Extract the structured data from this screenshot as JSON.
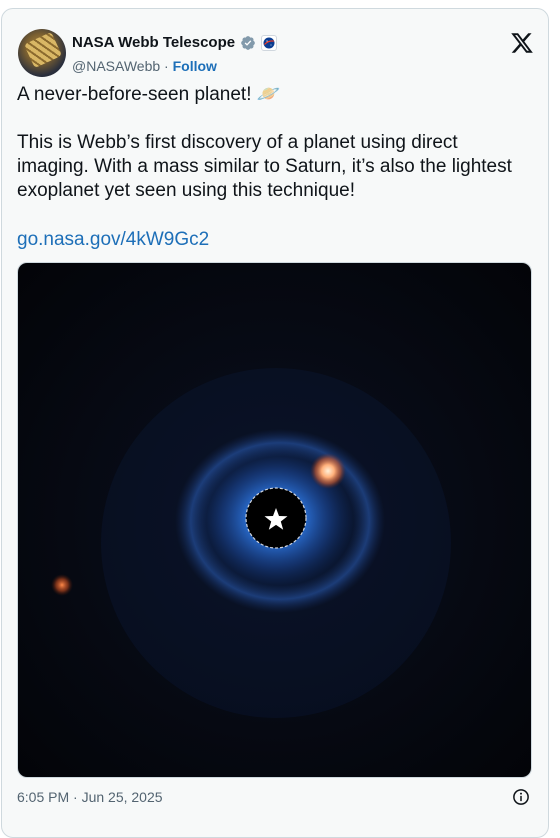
{
  "author": {
    "name": "NASA Webb Telescope",
    "handle": "@NASAWebb",
    "separator": "·",
    "follow_label": "Follow"
  },
  "tweet": {
    "line1": "A never-before-seen planet! 🪐",
    "line2": "This is Webb’s first discovery of a planet using direct imaging. With a mass similar to Saturn, it’s also the lightest exoplanet yet seen using this technique!",
    "link": "go.nasa.gov/4kW9Gc2"
  },
  "timestamp": "6:05 PM · Jun 25, 2025",
  "icons": {
    "verified": "verified-badge-icon",
    "org": "nasa-affiliate-badge-icon",
    "x": "x-logo-icon",
    "info": "info-icon",
    "star": "star-icon",
    "planet": "ringed-planet-emoji"
  },
  "colors": {
    "link": "#1d6fb8",
    "card_bg": "#f7f9f9",
    "border": "#cfd9de",
    "muted": "#536471"
  }
}
